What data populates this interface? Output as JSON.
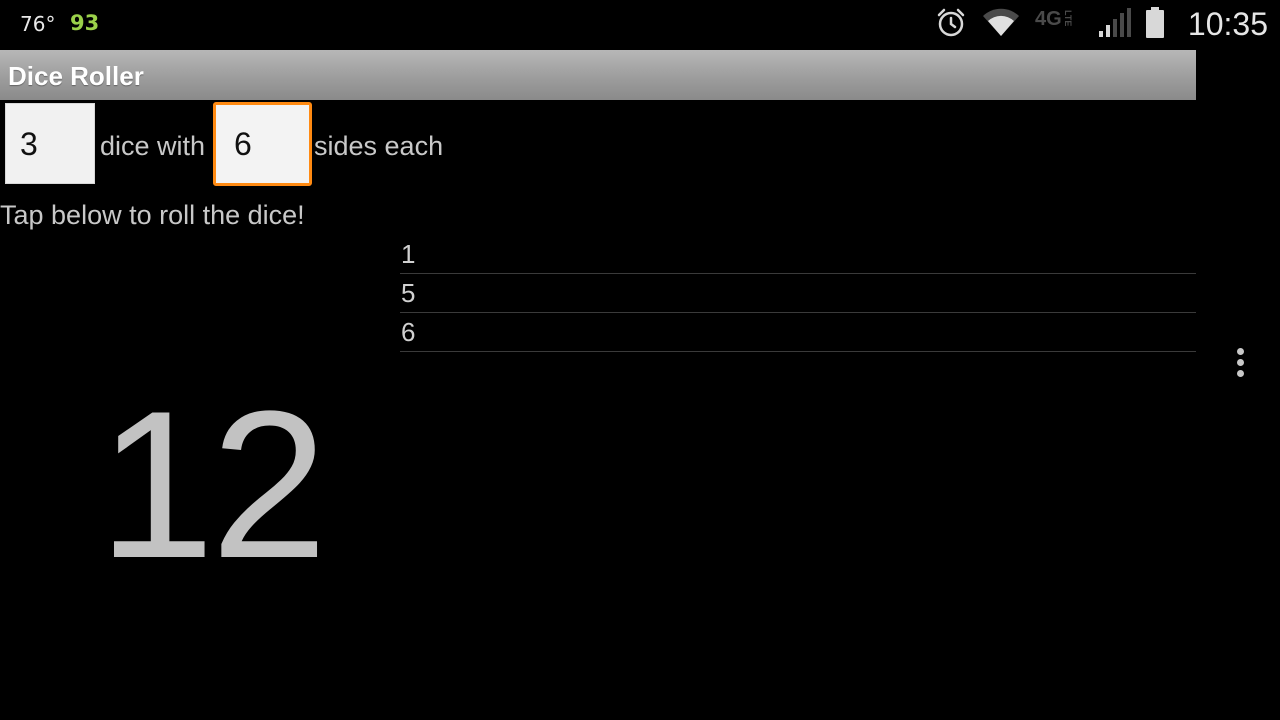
{
  "status_bar": {
    "temperature": "76°",
    "battery_level": "93",
    "network_label": "4G",
    "network_sub": "LTE",
    "time": "10:35",
    "icons": [
      "alarm-icon",
      "wifi-icon",
      "lte-icon",
      "signal-icon",
      "battery-icon"
    ]
  },
  "app": {
    "title": "Dice Roller"
  },
  "form": {
    "dice_count": "3",
    "dice_label": "dice with",
    "sides_count": "6",
    "sides_label": "sides each",
    "instruction": "Tap below to roll the dice!"
  },
  "results": {
    "rolls": [
      "1",
      "5",
      "6"
    ],
    "total": "12"
  },
  "colors": {
    "focus_accent": "#ff8a12",
    "battery_text": "#9bd14a"
  }
}
